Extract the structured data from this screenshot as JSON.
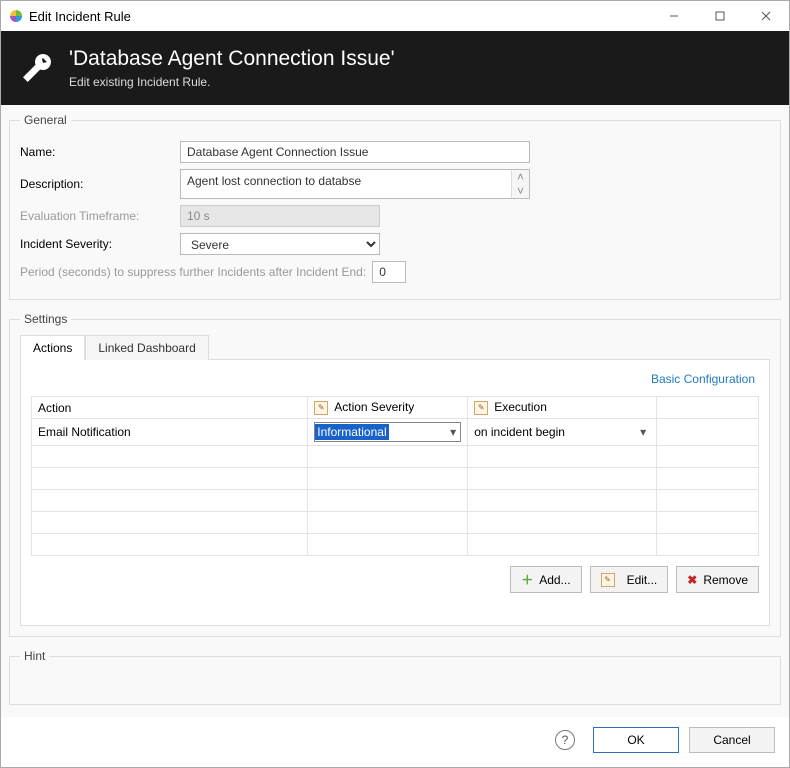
{
  "window": {
    "title": "Edit Incident Rule"
  },
  "header": {
    "title": "'Database Agent Connection Issue'",
    "subtitle": "Edit existing Incident Rule."
  },
  "general": {
    "legend": "General",
    "name_label": "Name:",
    "name_value": "Database Agent Connection Issue",
    "desc_label": "Description:",
    "desc_value": "Agent lost connection to databse",
    "eval_label": "Evaluation Timeframe:",
    "eval_value": "10 s",
    "sev_label": "Incident Severity:",
    "sev_value": "Severe",
    "period_label": "Period (seconds) to suppress further Incidents after Incident End:",
    "period_value": "0"
  },
  "settings": {
    "legend": "Settings",
    "tabs": {
      "actions": "Actions",
      "linked": "Linked Dashboard"
    },
    "basic_link": "Basic Configuration",
    "columns": {
      "action": "Action",
      "severity": "Action Severity",
      "execution": "Execution"
    },
    "rows": [
      {
        "action": "Email Notification",
        "severity": "Informational",
        "execution": "on incident begin"
      }
    ],
    "buttons": {
      "add": "Add...",
      "edit": "Edit...",
      "remove": "Remove"
    }
  },
  "hint": {
    "legend": "Hint"
  },
  "footer": {
    "ok": "OK",
    "cancel": "Cancel"
  }
}
